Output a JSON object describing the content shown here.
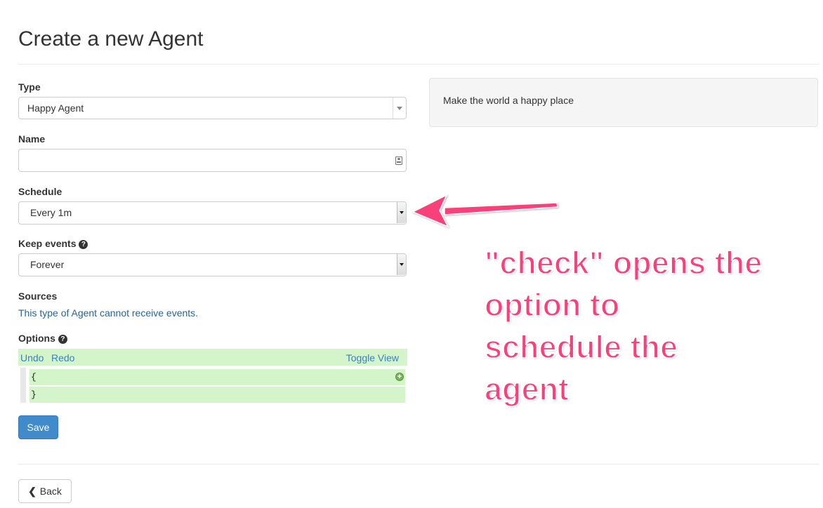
{
  "page": {
    "title": "Create a new Agent"
  },
  "form": {
    "type": {
      "label": "Type",
      "value": "Happy Agent"
    },
    "name": {
      "label": "Name",
      "value": "",
      "placeholder": ""
    },
    "schedule": {
      "label": "Schedule",
      "value": "Every 1m"
    },
    "keep_events": {
      "label": "Keep events",
      "help_icon": "?",
      "value": "Forever"
    },
    "sources": {
      "label": "Sources",
      "text": "This type of Agent cannot receive events."
    },
    "options": {
      "label": "Options",
      "help_icon": "?",
      "undo": "Undo",
      "redo": "Redo",
      "toggle_view": "Toggle View",
      "lines": [
        "{",
        "}"
      ],
      "add_icon": "+"
    },
    "save_label": "Save"
  },
  "back_label": "Back",
  "description": "Make the world a happy place",
  "annotation": {
    "lines": [
      "\"check\" opens the",
      "option to",
      "schedule the",
      "agent"
    ],
    "color": "#f8407a"
  },
  "colors": {
    "link": "#2a6496",
    "primary_button": "#428bca",
    "editor_highlight": "#d4f5c9"
  }
}
